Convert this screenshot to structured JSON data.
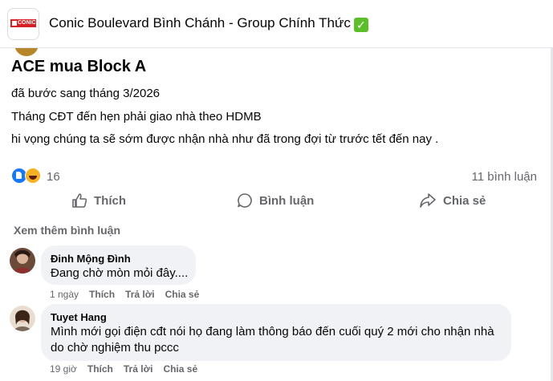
{
  "header": {
    "group_name": "Conic Boulevard Bình Chánh - Group Chính Thức",
    "logo_text": "CONIC",
    "verified_emoji": "✅"
  },
  "post": {
    "title": "ACE mua Block A",
    "lines": [
      "đã bước sang tháng 3/2026",
      "Tháng CĐT đến hẹn phải giao nhà theo HDMB",
      "hi vọng chúng ta sẽ sớm được nhận nhà như đã trong đợi từ trước tết đến nay ."
    ],
    "reaction_count": "16",
    "comment_count": "11 bình luận",
    "reaction_icons": [
      "like-reaction-icon",
      "haha-reaction-icon"
    ]
  },
  "actions": {
    "like": "Thích",
    "comment": "Bình luận",
    "share": "Chia sẻ"
  },
  "comments_section": {
    "see_more": "Xem thêm bình luận",
    "comments": [
      {
        "author": "Đinh Mộng Đình",
        "text": "Đang chờ mòn mỏi đây....",
        "time": "1 ngày",
        "like": "Thích",
        "reply": "Trả lời",
        "share": "Chia sẻ"
      },
      {
        "author": "Tuyet Hang",
        "text_line1": "Mình mới gọi điện cđt nói họ đang làm thông báo đến cuối quý 2 mới cho nhận nhà",
        "text_line2": "do chờ nghiệm thu pccc",
        "time": "19 giờ",
        "like": "Thích",
        "reply": "Trả lời",
        "share": "Chia sẻ"
      }
    ]
  },
  "colors": {
    "accent": "#1877f2",
    "secondary_text": "#65676b",
    "bubble": "#f0f2f5",
    "brand_red": "#d71f26"
  }
}
